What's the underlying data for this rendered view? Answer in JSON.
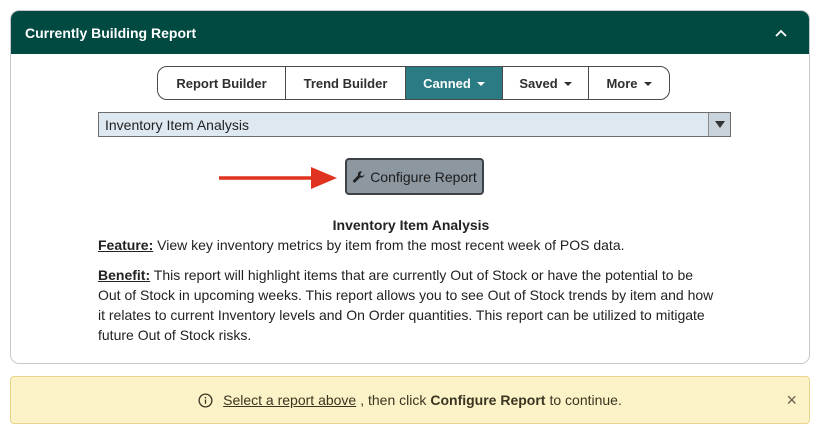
{
  "panel": {
    "title": "Currently Building Report"
  },
  "nav": {
    "items": [
      {
        "label": "Report Builder"
      },
      {
        "label": "Trend Builder"
      },
      {
        "label": "Canned"
      },
      {
        "label": "Saved"
      },
      {
        "label": "More"
      }
    ]
  },
  "report_select": {
    "value": "Inventory Item Analysis"
  },
  "configure_button": {
    "label": "Configure Report"
  },
  "report": {
    "title": "Inventory Item Analysis",
    "feature_label": "Feature:",
    "feature_text": " View key inventory metrics by item from the most recent week of POS data.",
    "benefit_label": "Benefit:",
    "benefit_text": " This report will highlight items that are currently Out of Stock or have the potential to be Out of Stock in upcoming weeks. This report allows you to see Out of Stock trends by item and how it relates to current Inventory levels and On Order quantities. This report can be utilized to mitigate future Out of Stock risks."
  },
  "alert": {
    "link_text": "Select a report above",
    "middle_text": ", then click",
    "strong_text": "Configure Report",
    "end_text": "to continue.",
    "close_glyph": "×"
  },
  "colors": {
    "header_bg": "#004a42",
    "active_tab": "#2b7b84",
    "arrow": "#e0331f",
    "alert_bg": "#fcf2c8"
  },
  "icons": [
    "chevron-up-icon",
    "caret-down-icon",
    "wrench-icon",
    "arrow-right-icon",
    "info-icon",
    "close-icon"
  ]
}
